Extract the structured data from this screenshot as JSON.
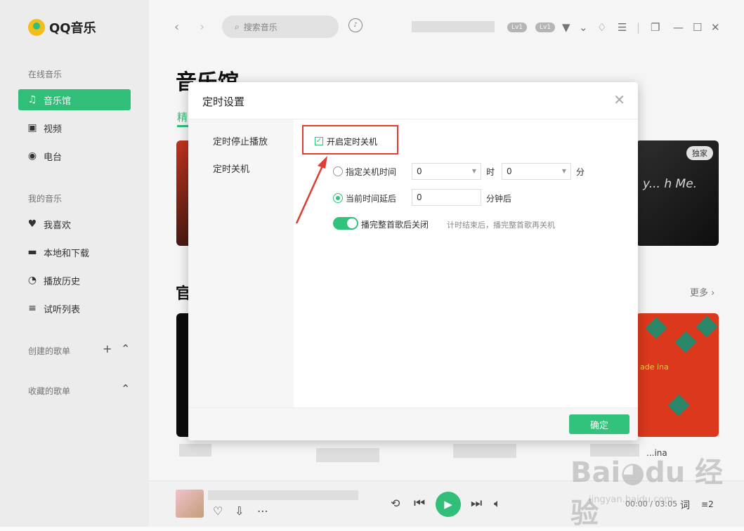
{
  "app": {
    "name": "QQ音乐"
  },
  "sidebar": {
    "online_title": "在线音乐",
    "online_items": [
      {
        "label": "音乐馆",
        "icon": "music-note-icon",
        "active": true
      },
      {
        "label": "视频",
        "icon": "video-icon",
        "active": false
      },
      {
        "label": "电台",
        "icon": "radio-icon",
        "active": false
      }
    ],
    "my_title": "我的音乐",
    "my_items": [
      {
        "label": "我喜欢",
        "icon": "heart-icon"
      },
      {
        "label": "本地和下载",
        "icon": "monitor-icon"
      },
      {
        "label": "播放历史",
        "icon": "clock-icon"
      },
      {
        "label": "试听列表",
        "icon": "playlist-icon"
      }
    ],
    "created_title": "创建的歌单",
    "collected_title": "收藏的歌单"
  },
  "topbar": {
    "search_placeholder": "搜索音乐",
    "badges": [
      "Lv1",
      "Lv1"
    ]
  },
  "main": {
    "page_title": "音乐馆",
    "tab_peek": "精",
    "section2_peek": "官",
    "more_label": "更多",
    "card_tag": "独家",
    "card_script": "y... h Me.",
    "card_caption": "ade   ina",
    "card_d_label": "...ina"
  },
  "player": {
    "time": "00:00 / 03:05",
    "lyric_label": "词",
    "queue_count": "2"
  },
  "dialog": {
    "title": "定时设置",
    "nav": [
      "定时停止播放",
      "定时关机"
    ],
    "enable_label": "开启定时关机",
    "enable_checked": true,
    "option1_label": "指定关机时间",
    "hour_value": "0",
    "hour_unit": "时",
    "minute_value": "0",
    "minute_unit": "分",
    "option2_label": "当前时间延后",
    "delay_value": "0",
    "delay_unit": "分钟后",
    "toggle_label": "播完整首歌后关闭",
    "toggle_on": true,
    "hint": "计时结束后，播完整首歌再关机",
    "confirm_label": "确定"
  },
  "colors": {
    "accent": "#31c27c",
    "annotation": "#e13b32"
  }
}
